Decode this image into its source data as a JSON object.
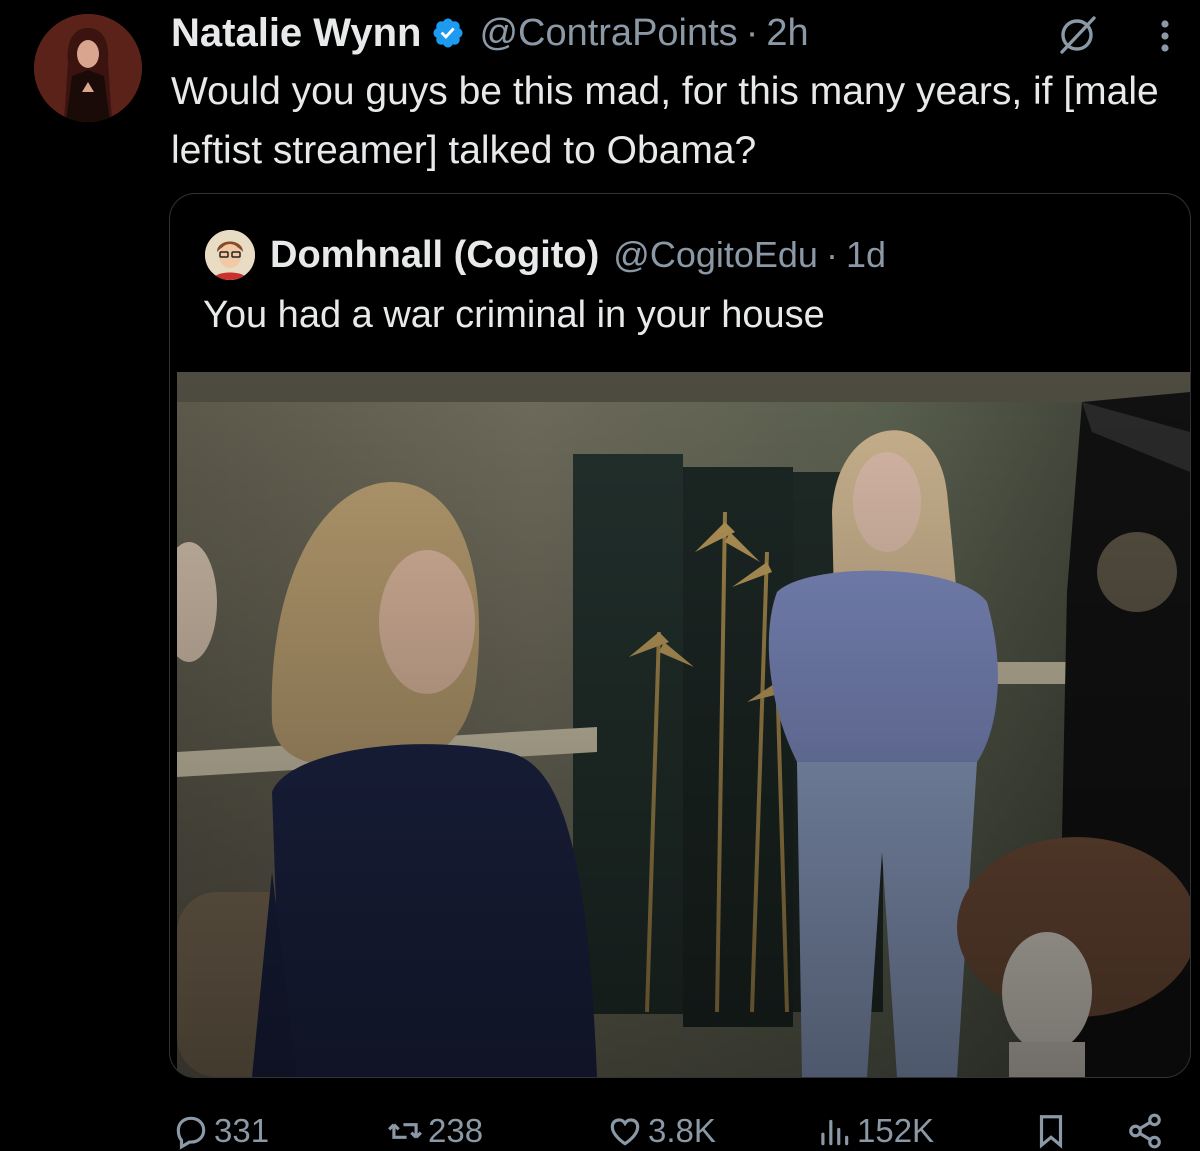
{
  "tweet": {
    "author_name": "Natalie Wynn",
    "author_handle": "@ContraPoints",
    "separator": "·",
    "time": "2h",
    "text": "Would you guys be this mad, for this many years, if [male leftist streamer] talked to Obama?",
    "avatar_icon": "profile-photo"
  },
  "quote": {
    "author_name": "Domhnall (Cogito)",
    "author_handle": "@CogitoEdu",
    "separator": "·",
    "time": "1d",
    "text": "You had a war criminal in your house",
    "media_icon": "photo"
  },
  "actions": {
    "reply_count": "331",
    "retweet_count": "238",
    "like_count": "3.8K",
    "views_count": "152K"
  },
  "colors": {
    "background": "#000000",
    "text_primary": "#e7e9ea",
    "text_secondary": "#8b98a5",
    "verified": "#1d9bf0",
    "border": "#2f3336"
  }
}
